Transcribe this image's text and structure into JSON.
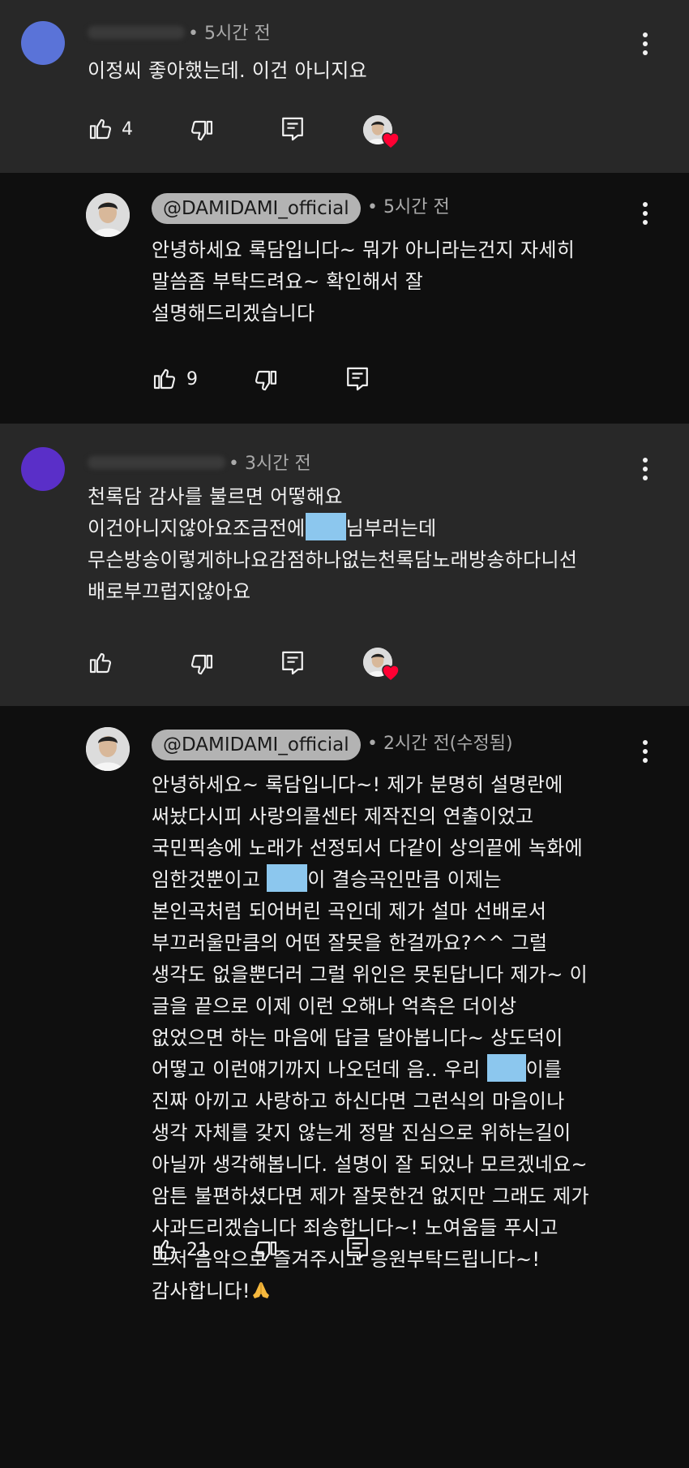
{
  "comments": [
    {
      "time": "• 5시간 전",
      "text": [
        "이정씨 좋아했는데. 이건 아니지요"
      ],
      "likes": "4"
    },
    {
      "author": "@DAMIDAMI_official",
      "time": "• 5시간 전",
      "text": [
        "안녕하세요 록담입니다~ 뭐가 아니라는건지 자세히",
        "말씀좀 부탁드려요~ 확인해서 잘",
        "설명해드리겠습니다"
      ],
      "likes": "9"
    },
    {
      "time": "• 3시간 전",
      "text_line1": "천록담 감사를 불르면 어떻해요",
      "text_line2_a": "이건아니지않아요조금전에",
      "text_line2_b": "님부러는데",
      "text_line3": "무슨방송이렇게하나요감점하나없는천록담노래방송하다니선",
      "text_line4": "배로부끄럽지않아요"
    },
    {
      "author": "@DAMIDAMI_official",
      "time": "• 2시간 전(수정됨)",
      "l1": "안녕하세요~ 록담입니다~! 제가 분명히 설명란에",
      "l2": "써놨다시피 사랑의콜센타 제작진의 연출이었고",
      "l3": "국민픽송에 노래가 선정되서 다같이 상의끝에 녹화에",
      "l4a": "임한것뿐이고",
      "l4b": "이 결승곡인만큼 이제는",
      "l5": "본인곡처럼 되어버린 곡인데 제가 설마 선배로서",
      "l6": "부끄러울만큼의 어떤 잘못을 한걸까요?^^ 그럴",
      "l7": "생각도 없을뿐더러 그럴 위인은 못된답니다 제가~ 이",
      "l8": "글을 끝으로 이제 이런 오해나 억측은 더이상",
      "l9": "없었으면 하는 마음에 답글 달아봅니다~ 상도덕이",
      "l10a": "어떻고 이런얘기까지 나오던데 음.. 우리",
      "l10b": "이를",
      "l11": "진짜 아끼고 사랑하고 하신다면 그런식의 마음이나",
      "l12": "생각 자체를 갖지 않는게 정말 진심으로 위하는길이",
      "l13": "아닐까 생각해봅니다. 설명이 잘 되었나 모르겠네요~",
      "l14": "암튼 불편하셨다면 제가 잘못한건 없지만 그래도 제가",
      "l15": "사과드리겠습니다 죄송합니다~! 노여움들 푸시고",
      "l16": "그저 음악으로 즐겨주시고 응원부탁드립니다~!",
      "l17": "감사합니다!",
      "likes": "21"
    }
  ],
  "icons": {
    "like": "thumbs-up-icon",
    "dislike": "thumbs-down-icon",
    "reply": "reply-icon",
    "more": "more-vert-icon",
    "heart": "creator-heart-icon",
    "emoji": "folded-hands-emoji"
  },
  "colors": {
    "censor": "#8cc7ee",
    "heart": "#ff0033",
    "chip": "#b3b3b3"
  }
}
